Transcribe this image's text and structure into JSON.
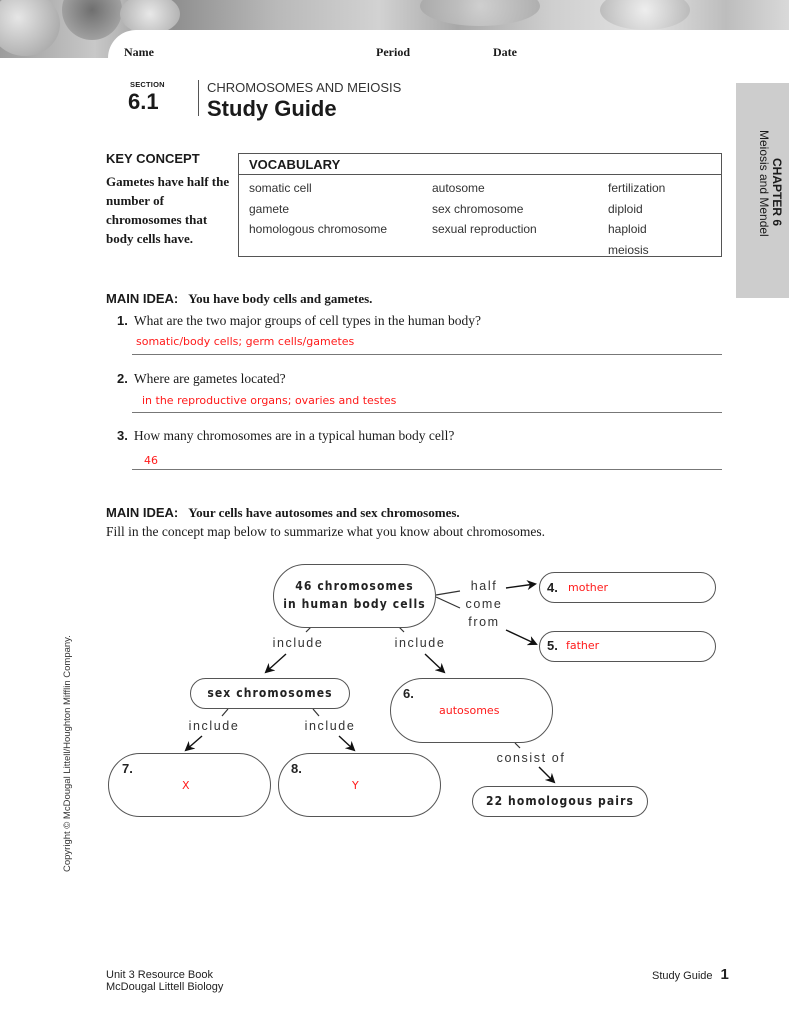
{
  "header": {
    "name_label": "Name",
    "period_label": "Period",
    "date_label": "Date"
  },
  "section": {
    "word": "SECTION",
    "number": "6.1",
    "subtitle": "CHROMOSOMES AND MEIOSIS",
    "title": "Study Guide"
  },
  "chapter_tab": {
    "chapter": "CHAPTER 6",
    "name": "Meiosis and Mendel"
  },
  "key_concept": {
    "title": "KEY CONCEPT",
    "text": "Gametes have half the number of chromosomes that body cells have."
  },
  "vocabulary": {
    "title": "VOCABULARY",
    "columns": [
      [
        "somatic cell",
        "gamete",
        "homologous chromosome"
      ],
      [
        "autosome",
        "sex chromosome",
        "sexual reproduction"
      ],
      [
        "fertilization",
        "diploid",
        "haploid",
        "meiosis"
      ]
    ]
  },
  "main_idea_1": {
    "label": "MAIN IDEA:",
    "text": "You have body cells and gametes.",
    "questions": [
      {
        "number": "1.",
        "text": "What are the two major groups of cell types in the human body?",
        "answer": "somatic/body cells; germ cells/gametes"
      },
      {
        "number": "2.",
        "text": "Where are gametes located?",
        "answer": "in the reproductive organs; ovaries and testes"
      },
      {
        "number": "3.",
        "text": "How many chromosomes are in a typical human body cell?",
        "answer": "46"
      }
    ]
  },
  "main_idea_2": {
    "label": "MAIN IDEA:",
    "text": "Your cells have autosomes and sex chromosomes.",
    "instruction": "Fill in the concept map below to summarize what you know about chromosomes."
  },
  "concept_map": {
    "root": {
      "line1": "46 chromosomes",
      "line2": "in human body cells"
    },
    "half_come_from": {
      "line1": "half",
      "line2": "come",
      "line3": "from"
    },
    "include_left": "include",
    "include_right": "include",
    "node4": {
      "number": "4.",
      "answer": "mother"
    },
    "node5": {
      "number": "5.",
      "answer": "father"
    },
    "sex_chromosomes": "sex chromosomes",
    "node6": {
      "number": "6.",
      "answer": "autosomes"
    },
    "include_sex_left": "include",
    "include_sex_right": "include",
    "node7": {
      "number": "7.",
      "answer": "X"
    },
    "node8": {
      "number": "8.",
      "answer": "Y"
    },
    "consist_of": "consist of",
    "homologous_pairs": "22 homologous pairs"
  },
  "copyright": "Copyright © McDougal Littell/Houghton Mifflin Company.",
  "footer": {
    "book": "Unit 3 Resource Book",
    "series": "McDougal Littell Biology",
    "section_label": "Study Guide",
    "page_number": "1"
  },
  "colors": {
    "answer": "#ff1a1a",
    "chapter_tab": "#cdcdcd"
  }
}
